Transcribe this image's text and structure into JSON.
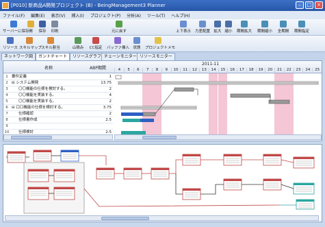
{
  "window": {
    "title": "[P010] 新商品A開発プロジェクト (B) - BeingManagement3 Planner",
    "controls": [
      "minimize",
      "maximize",
      "close"
    ]
  },
  "menu": [
    "ファイル(F)",
    "編集(E)",
    "表示(V)",
    "挿入(I)",
    "プロジェクト(P)",
    "分析(A)",
    "ツール(T)",
    "ヘルプ(H)"
  ],
  "toolbar1": {
    "buttons": [
      "サーバーに保存",
      "開",
      "保存",
      "印刷",
      "元に戻す",
      "上下表示",
      "力差配置",
      "拡大",
      "縮小",
      "期間拡大",
      "期間縮小",
      "全期間",
      "期間指定"
    ]
  },
  "toolbar2": {
    "buttons": [
      "リソース",
      "スキルマップ",
      "スキル割当",
      "山積み",
      "CC指定",
      "バッファ挿入",
      "状態",
      "プロジェクトメモ"
    ]
  },
  "tabs": [
    "ネットワーク図",
    "ガントチャート",
    "リソースグラフ",
    "チェーンモニター",
    "リソースモニター"
  ],
  "active_tab": "ガントチャート",
  "grid": {
    "col_name": "名称",
    "col_period": "ABP期間",
    "month": "2011-11",
    "days": [
      "4",
      "5",
      "6",
      "7",
      "8",
      "9",
      "10",
      "11",
      "12",
      "13",
      "14",
      "15",
      "16",
      "17",
      "18",
      "19",
      "20",
      "21",
      "22",
      "23",
      "24",
      "25"
    ],
    "weekend_days": [
      "7",
      "8",
      "14",
      "15",
      "21",
      "22"
    ],
    "rows": [
      {
        "num": "1",
        "name": "要件定義",
        "period": "1"
      },
      {
        "num": "2",
        "name": "⊟ システム開発",
        "period": "13.75"
      },
      {
        "num": "3",
        "name": "〇〇機能の仕様を検討する。",
        "period": "2"
      },
      {
        "num": "4",
        "name": "〇〇機能を実装する。",
        "period": "4"
      },
      {
        "num": "5",
        "name": "〇〇機能を実装する。",
        "period": "2"
      },
      {
        "num": "6",
        "name": "⊟ 口口機能の仕様を検討する。",
        "period": "3.75"
      },
      {
        "num": "7",
        "name": "仕様確認",
        "period": "2"
      },
      {
        "num": "8",
        "name": "仕様書作成",
        "period": "2.5"
      },
      {
        "num": "9",
        "name": "",
        "period": ""
      },
      {
        "num": "10",
        "name": "仕様検討",
        "period": "2.5"
      }
    ]
  },
  "colors": {
    "weekend": "#f4c6d6",
    "bar_blue": "#2d5fc4",
    "bar_teal": "#2aa7a0",
    "bar_hatch": "#9a9a9a",
    "node_red": "#c04848"
  }
}
